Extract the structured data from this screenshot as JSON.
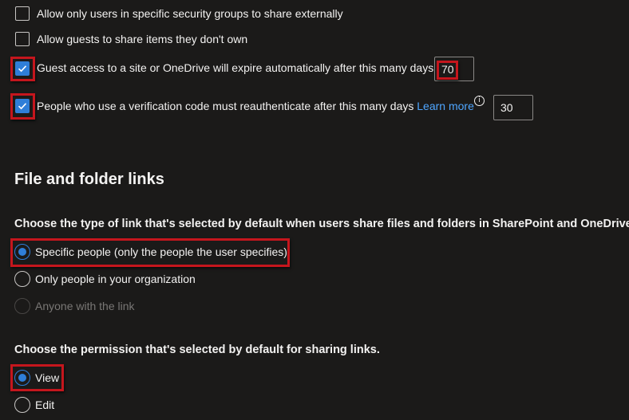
{
  "external_sharing": {
    "items": [
      {
        "label": "Allow only users in specific security groups to share externally",
        "checked": false
      },
      {
        "label": "Allow guests to share items they don't own",
        "checked": false
      },
      {
        "label": "Guest access to a site or OneDrive will expire automatically after this many days",
        "checked": true,
        "value": "70"
      },
      {
        "label": "People who use a verification code must reauthenticate after this many days",
        "checked": true,
        "link": "Learn more",
        "value": "30"
      }
    ]
  },
  "file_links": {
    "heading": "File and folder links",
    "type_question": "Choose the type of link that's selected by default when users share files and folders in SharePoint and OneDrive.",
    "type_options": [
      {
        "label": "Specific people (only the people the user specifies)",
        "selected": true,
        "enabled": true
      },
      {
        "label": "Only people in your organization",
        "selected": false,
        "enabled": true
      },
      {
        "label": "Anyone with the link",
        "selected": false,
        "enabled": false
      }
    ],
    "permission_question": "Choose the permission that's selected by default for sharing links.",
    "permission_options": [
      {
        "label": "View",
        "selected": true
      },
      {
        "label": "Edit",
        "selected": false
      }
    ]
  },
  "icons": {
    "checkmark": "checkmark-icon",
    "info": "info-icon",
    "info_glyph": "i"
  },
  "colors": {
    "background": "#1b1a19",
    "accent": "#2f7ed8",
    "link": "#4fa6ff",
    "highlight": "#c5161d"
  }
}
